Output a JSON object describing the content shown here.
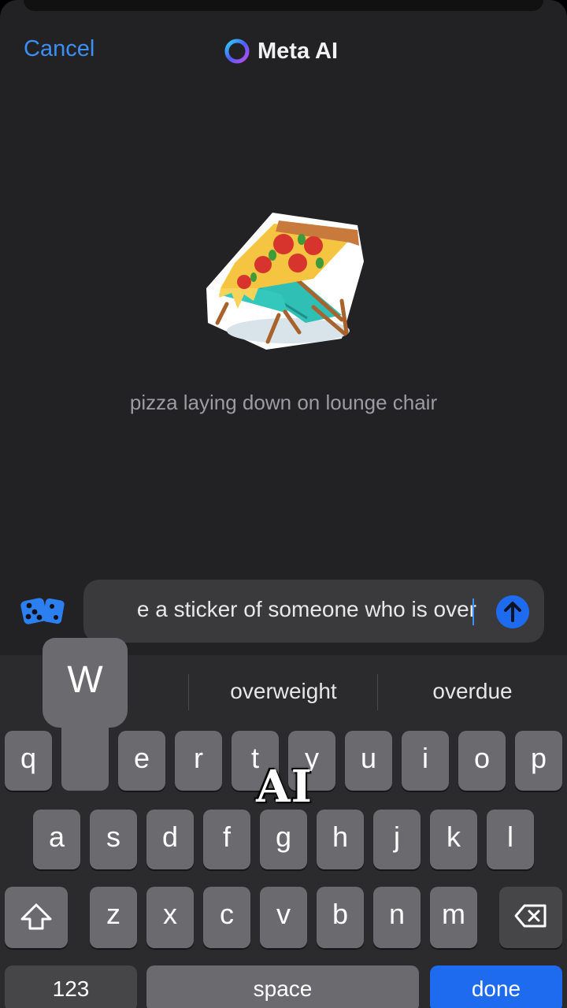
{
  "header": {
    "cancel_label": "Cancel",
    "title": "Meta AI"
  },
  "result": {
    "caption": "pizza laying down on lounge chair",
    "sticker_icon": "pizza-lounge-chair-sticker"
  },
  "composer": {
    "text": "e a sticker of someone who is over",
    "dice_icon": "dice-icon",
    "send_icon": "arrow-up-icon"
  },
  "suggestions": [
    "overweight",
    "overdue"
  ],
  "key_preview": "W",
  "keyboard": {
    "row1": [
      "q",
      "w",
      "e",
      "r",
      "t",
      "y",
      "u",
      "i",
      "o",
      "p"
    ],
    "row2": [
      "a",
      "s",
      "d",
      "f",
      "g",
      "h",
      "j",
      "k",
      "l"
    ],
    "row3": [
      "z",
      "x",
      "c",
      "v",
      "b",
      "n",
      "m"
    ],
    "numbers_label": "123",
    "space_label": "space",
    "done_label": "done"
  },
  "watermark": "AI",
  "colors": {
    "accent": "#3b8ff5",
    "send": "#1f6bf0",
    "background": "#222224"
  }
}
